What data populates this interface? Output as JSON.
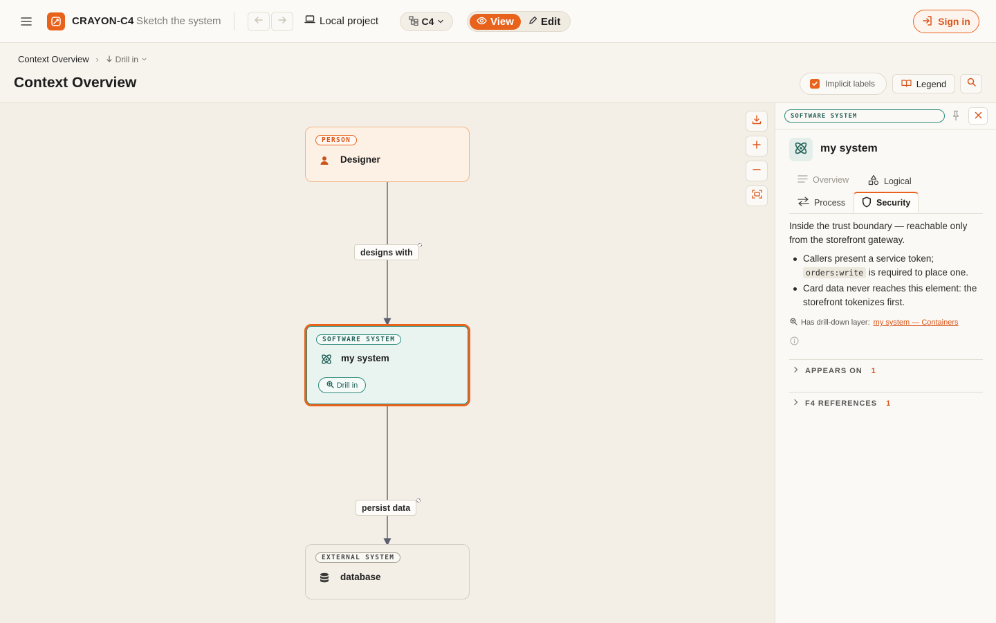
{
  "header": {
    "app_name": "CRAYON-C4",
    "tagline": "Sketch the system",
    "project_label": "Local project",
    "notation": "C4",
    "mode_view": "View",
    "mode_edit": "Edit",
    "sign_in": "Sign in"
  },
  "breadcrumb": {
    "current": "Context Overview",
    "separator": "›",
    "drill_label": "Drill in"
  },
  "page": {
    "title": "Context Overview",
    "implicit_labels": "Implicit labels",
    "implicit_labels_checked": true,
    "legend": "Legend"
  },
  "diagram": {
    "nodes": [
      {
        "kind": "PERSON",
        "name": "Designer",
        "icon": "person-icon"
      },
      {
        "kind": "SOFTWARE SYSTEM",
        "name": "my system",
        "icon": "atom-icon",
        "action": "Drill in",
        "selected": true
      },
      {
        "kind": "EXTERNAL SYSTEM",
        "name": "database",
        "icon": "database-icon"
      }
    ],
    "edges": [
      {
        "label": "designs with"
      },
      {
        "label": "persist data"
      }
    ]
  },
  "panel": {
    "tag": "SOFTWARE SYSTEM",
    "name": "my system",
    "tabs": {
      "overview": "Overview",
      "logical": "Logical",
      "process": "Process",
      "security": "Security"
    },
    "active_tab": "Security",
    "description": "Inside the trust boundary — reachable only from the storefront gateway.",
    "bullets": {
      "b1_pre": "Callers present a service token;",
      "b1_code": "orders:write",
      "b1_post": "is required to place one.",
      "b2": "Card data never reaches this element: the storefront tokenizes first."
    },
    "drill_prefix": "Has drill-down layer:",
    "drill_link": "my system — Containers",
    "appears_on": {
      "label": "APPEARS ON",
      "count": "1"
    },
    "f4_refs": {
      "label": "F4 REFERENCES",
      "count": "1"
    }
  },
  "colors": {
    "accent": "#e8621c",
    "teal": "#2d8a7a",
    "background": "#f7f4ee"
  }
}
